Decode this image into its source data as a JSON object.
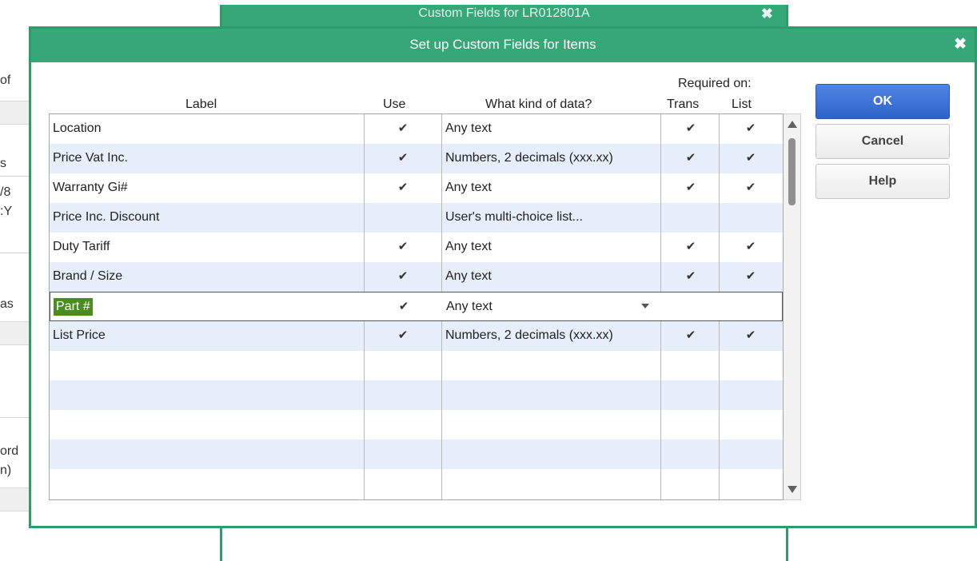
{
  "background_window": {
    "title": "Custom Fields for LR012801A",
    "close_glyph": "✖",
    "fragments": [
      "of",
      "s",
      "/8",
      ":Y",
      "as",
      "ord",
      "n)"
    ]
  },
  "dialog": {
    "title": "Set up Custom Fields for Items",
    "close_glyph": "✖"
  },
  "headers": {
    "required_on": "Required on:",
    "label": "Label",
    "use": "Use",
    "kind": "What kind of data?",
    "trans": "Trans",
    "list": "List"
  },
  "check_glyph": "✔",
  "rows": [
    {
      "label": "Location",
      "use": "✔",
      "kind": "Any text",
      "trans": "✔",
      "list": "✔"
    },
    {
      "label": "Price Vat Inc.",
      "use": "✔",
      "kind": "Numbers, 2 decimals (xxx.xx)",
      "trans": "✔",
      "list": "✔"
    },
    {
      "label": "Warranty Gi#",
      "use": "✔",
      "kind": "Any text",
      "trans": "✔",
      "list": "✔"
    },
    {
      "label": "Price Inc. Discount",
      "use": "",
      "kind": "User's multi-choice list...",
      "trans": "",
      "list": ""
    },
    {
      "label": "Duty Tariff",
      "use": "✔",
      "kind": "Any text",
      "trans": "✔",
      "list": "✔"
    },
    {
      "label": "Brand / Size",
      "use": "✔",
      "kind": "Any text",
      "trans": "✔",
      "list": "✔"
    },
    {
      "label": "Part #",
      "use": "✔",
      "kind": "Any text",
      "trans": "",
      "list": ""
    },
    {
      "label": "List Price",
      "use": "✔",
      "kind": "Numbers, 2 decimals (xxx.xx)",
      "trans": "✔",
      "list": "✔"
    }
  ],
  "buttons": {
    "ok": "OK",
    "cancel": "Cancel",
    "help": "Help"
  },
  "colors": {
    "titlebar": "#36a877",
    "frame": "#2e9b6a",
    "alt_row": "#e6eef9",
    "selection": "#4b8c1e",
    "ok_button": "#2d63c9"
  }
}
